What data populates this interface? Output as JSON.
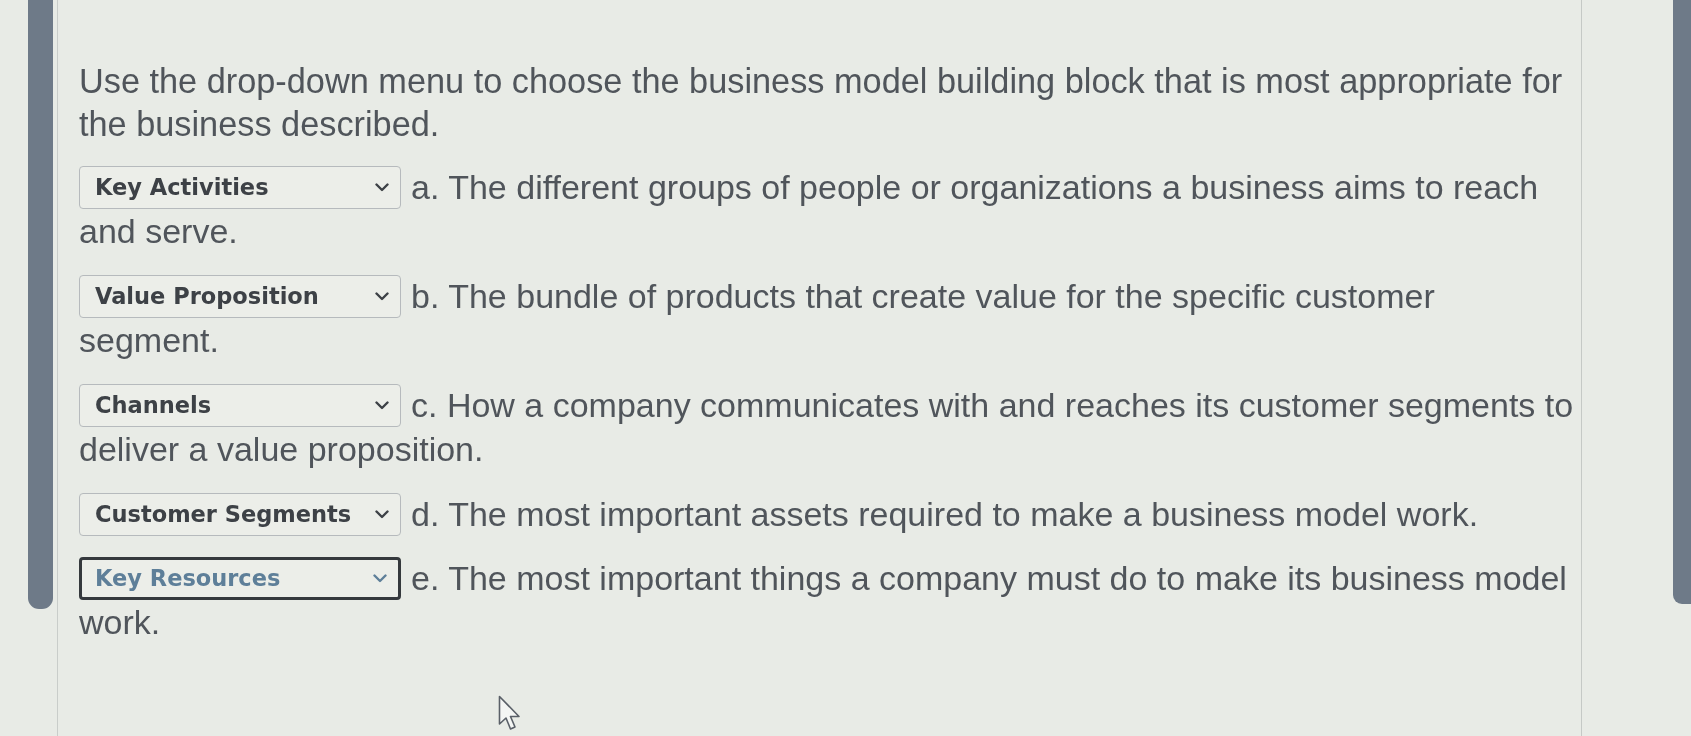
{
  "instruction": "Use the drop-down menu to choose the business model building block that is most appropriate for the business described.",
  "items": [
    {
      "selection": "Key Activities",
      "text_lines": [
        "a. The different groups of people or organizations a business aims to reach",
        "and serve."
      ],
      "focused": false
    },
    {
      "selection": "Value Proposition",
      "text_lines": [
        "b. The bundle of products that create value for the specific customer",
        "segment."
      ],
      "focused": false
    },
    {
      "selection": "Channels",
      "text_lines": [
        "c. How a company communicates with and reaches its customer segments to",
        "deliver a value proposition."
      ],
      "focused": false
    },
    {
      "selection": "Customer Segments",
      "text_lines": [
        "d. The most important assets required to make a business model work."
      ],
      "focused": false
    },
    {
      "selection": "Key Resources",
      "text_lines": [
        "e. The most important things a company must do to make its business model",
        "work."
      ],
      "focused": true
    }
  ]
}
